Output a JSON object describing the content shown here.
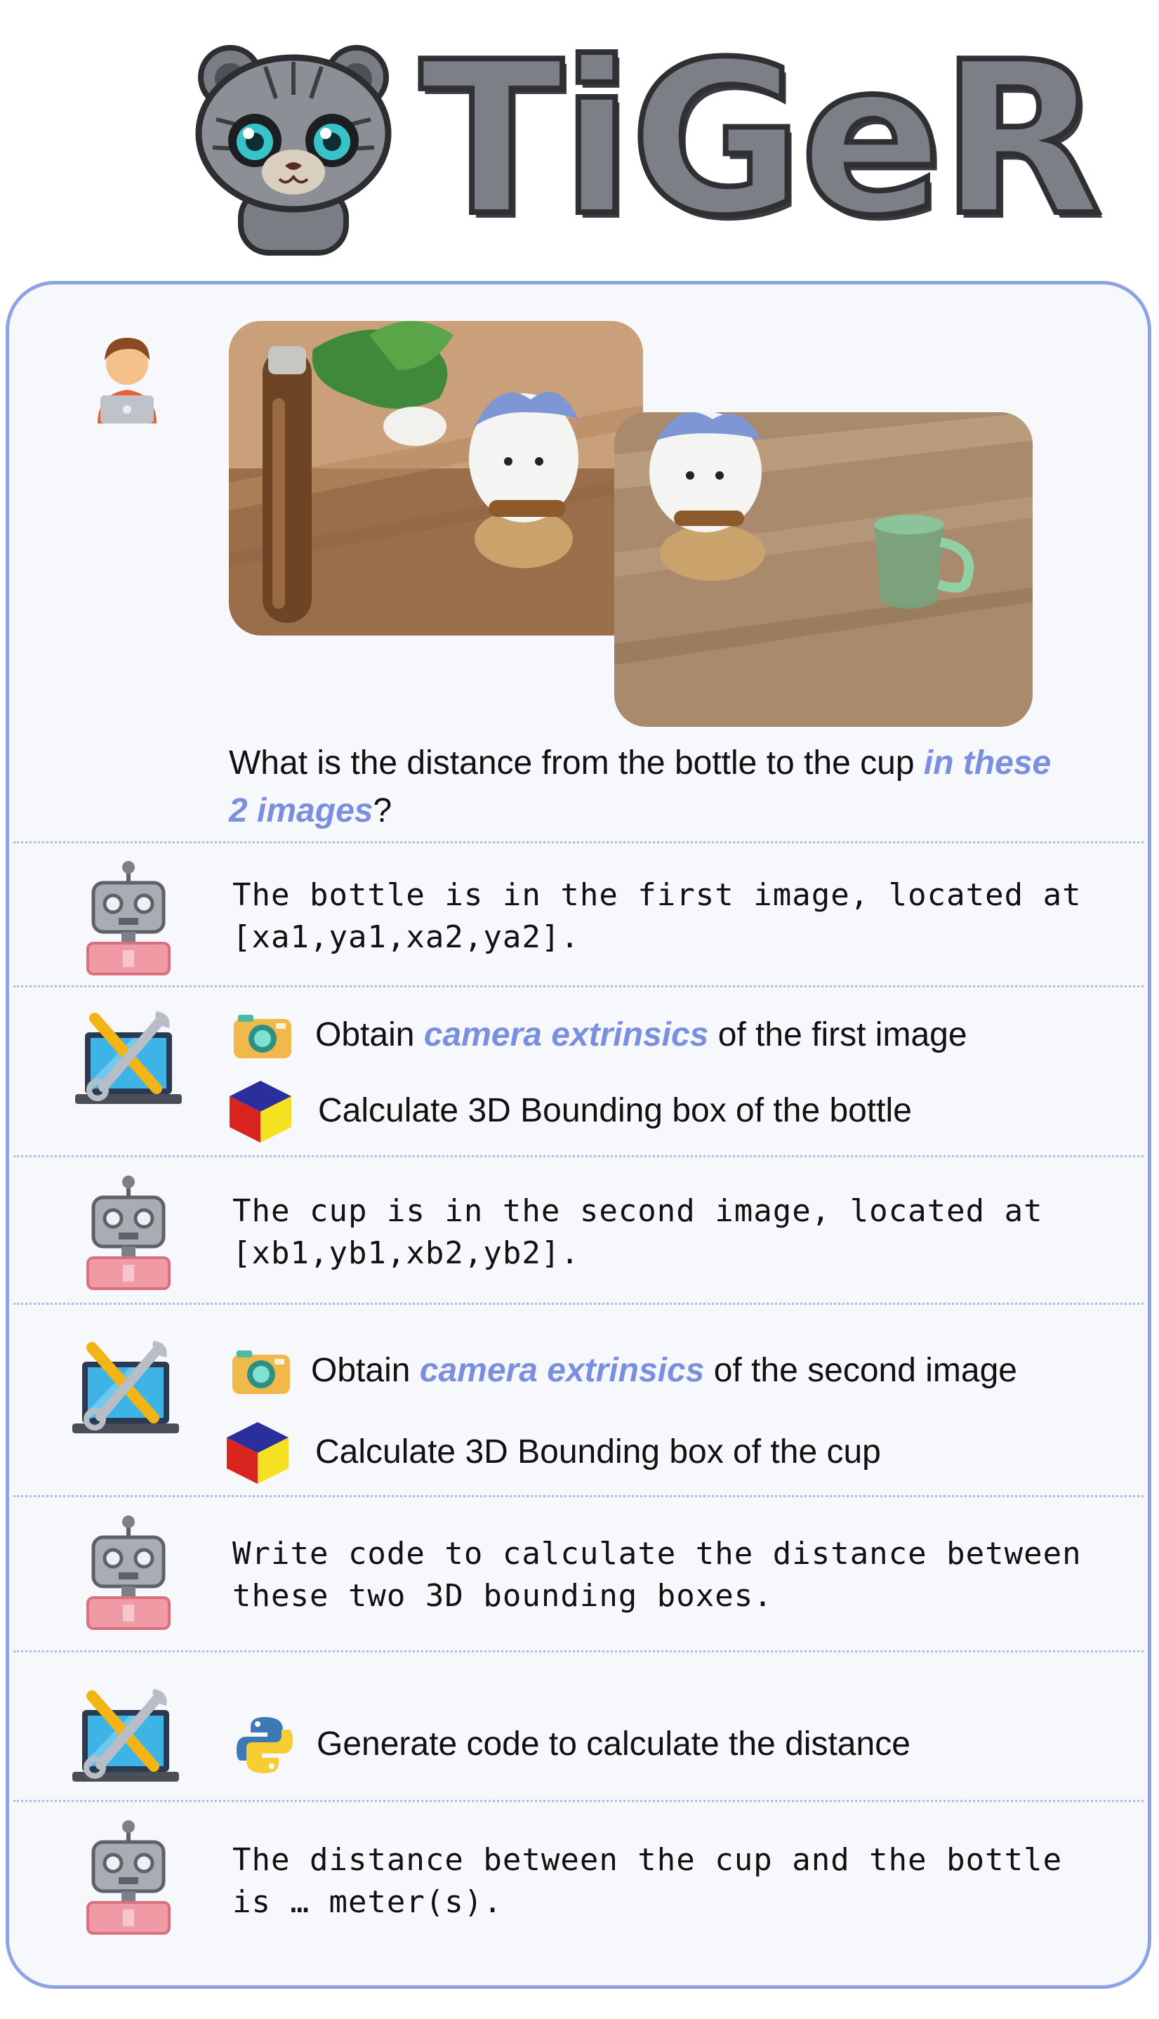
{
  "logo": {
    "title": "TiGeR"
  },
  "user_query": {
    "text_before": "What is the distance from the bottle to the cup ",
    "highlight": "in these",
    "highlight2": "2 images",
    "text_after": "?"
  },
  "steps": [
    {
      "role": "robot",
      "line1": "The bottle is in the first image, located at",
      "line2": "[xa1,ya1,xa2,ya2]."
    },
    {
      "role": "tool",
      "tool1": {
        "prefix": "Obtain ",
        "emphasis": "camera extrinsics",
        "suffix": " of the first image"
      },
      "tool2": {
        "text": "Calculate 3D Bounding box of the bottle"
      }
    },
    {
      "role": "robot",
      "line1": "The cup is in the second image, located at",
      "line2": "[xb1,yb1,xb2,yb2]."
    },
    {
      "role": "tool",
      "tool1": {
        "prefix": "Obtain ",
        "emphasis": "camera extrinsics",
        "suffix": " of the second image"
      },
      "tool2": {
        "text": "Calculate 3D Bounding box of the cup"
      }
    },
    {
      "role": "robot",
      "line1": "Write code to calculate the distance between",
      "line2": "these two 3D bounding boxes."
    },
    {
      "role": "tool",
      "tool1": {
        "text": "Generate code to calculate the distance"
      }
    },
    {
      "role": "robot",
      "line1": "The distance between the cup and the bottle",
      "line2": "is … meter(s)."
    }
  ],
  "colors": {
    "accent": "#7b8fe0",
    "border": "#8ea2e6",
    "separator": "#aebbe8"
  },
  "icons": [
    "user-icon",
    "robot-icon",
    "tool-laptop-icon",
    "camera-icon",
    "cube-icon",
    "python-icon"
  ]
}
